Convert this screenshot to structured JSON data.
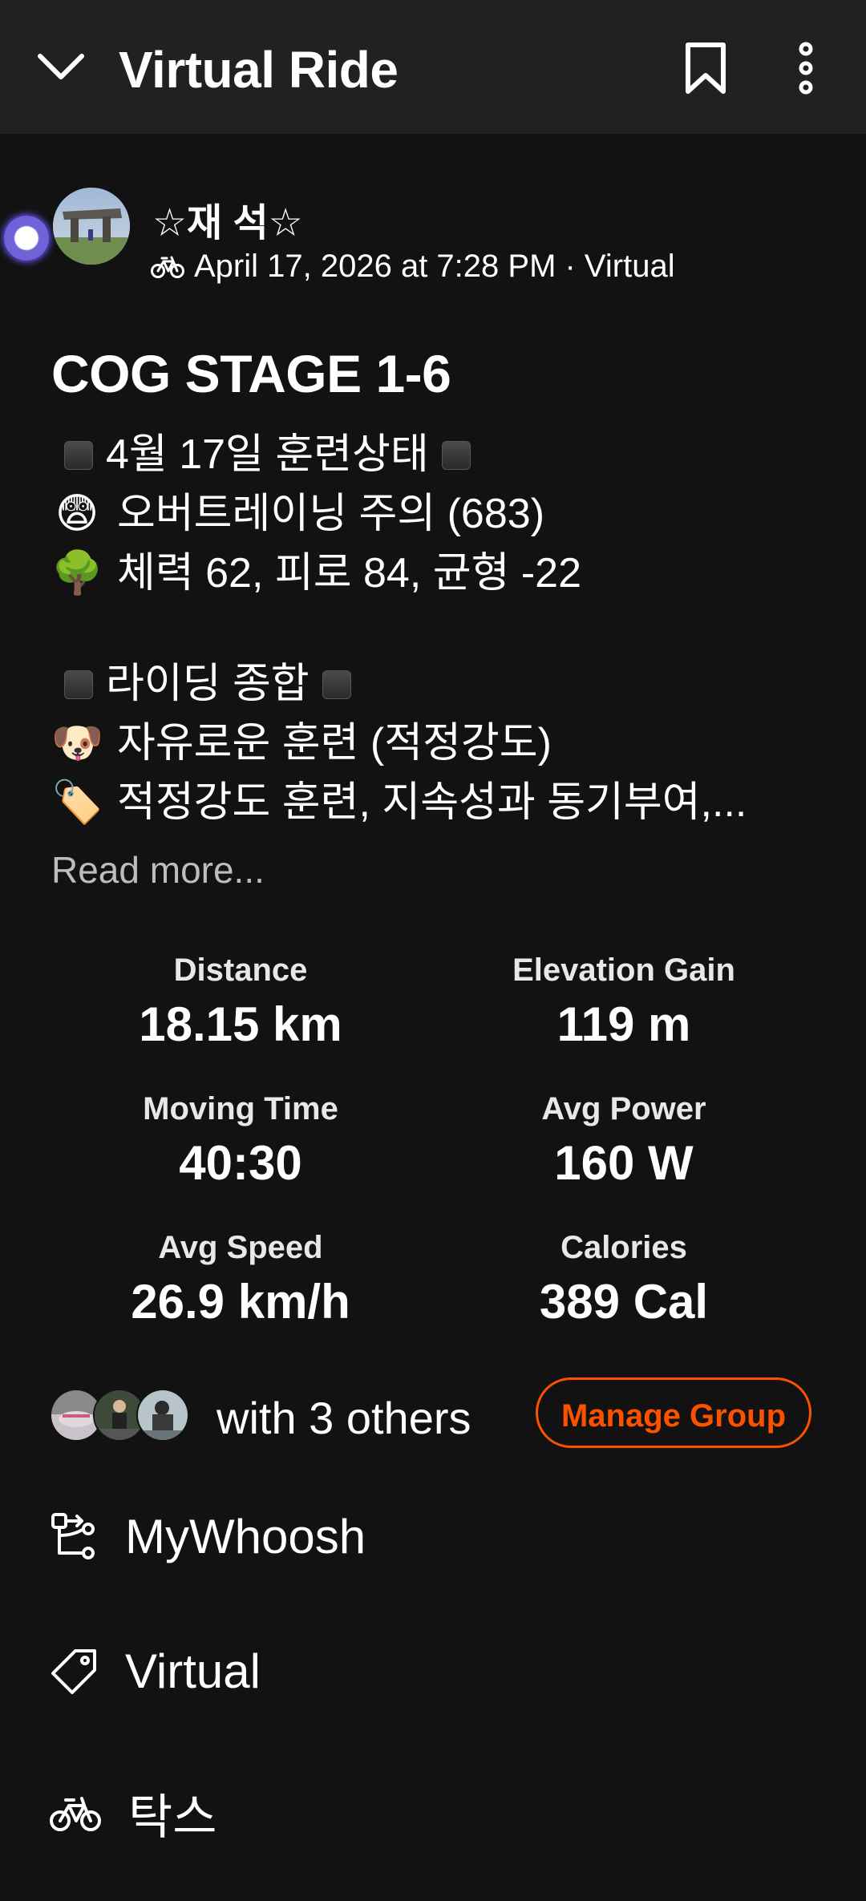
{
  "header": {
    "title": "Virtual Ride",
    "collapse_icon": "chevron-down-icon",
    "bookmark_icon": "bookmark-icon",
    "more_icon": "more-vertical-icon"
  },
  "activity": {
    "author": "☆재 석☆",
    "meta": "April 17, 2026 at 7:28 PM · Virtual",
    "title": "COG STAGE 1-6",
    "description": [
      "4월 17일 훈련상태",
      "오버트레이닝 주의 (683)",
      "체력 62, 피로 84, 균형 -22",
      "",
      "라이딩 종합",
      "자유로운 훈련 (적정강도)",
      "적정강도 훈련, 지속성과 동기부여,..."
    ],
    "description_emojis": [
      "😨",
      "🌳",
      "🐶",
      "🏷️"
    ],
    "read_more": "Read more..."
  },
  "stats": [
    {
      "label": "Distance",
      "value": "18.15 km"
    },
    {
      "label": "Elevation Gain",
      "value": "119 m"
    },
    {
      "label": "Moving Time",
      "value": "40:30"
    },
    {
      "label": "Avg Power",
      "value": "160 W"
    },
    {
      "label": "Avg Speed",
      "value": "26.9 km/h"
    },
    {
      "label": "Calories",
      "value": "389 Cal"
    }
  ],
  "group": {
    "text": "with 3 others",
    "button": "Manage Group"
  },
  "details": [
    {
      "icon": "route-icon",
      "label": "MyWhoosh"
    },
    {
      "icon": "tag-icon",
      "label": "Virtual"
    },
    {
      "icon": "bike-icon",
      "label": "탁스"
    }
  ],
  "colors": {
    "accent": "#fc5200",
    "background": "#121212",
    "header": "#212121"
  }
}
